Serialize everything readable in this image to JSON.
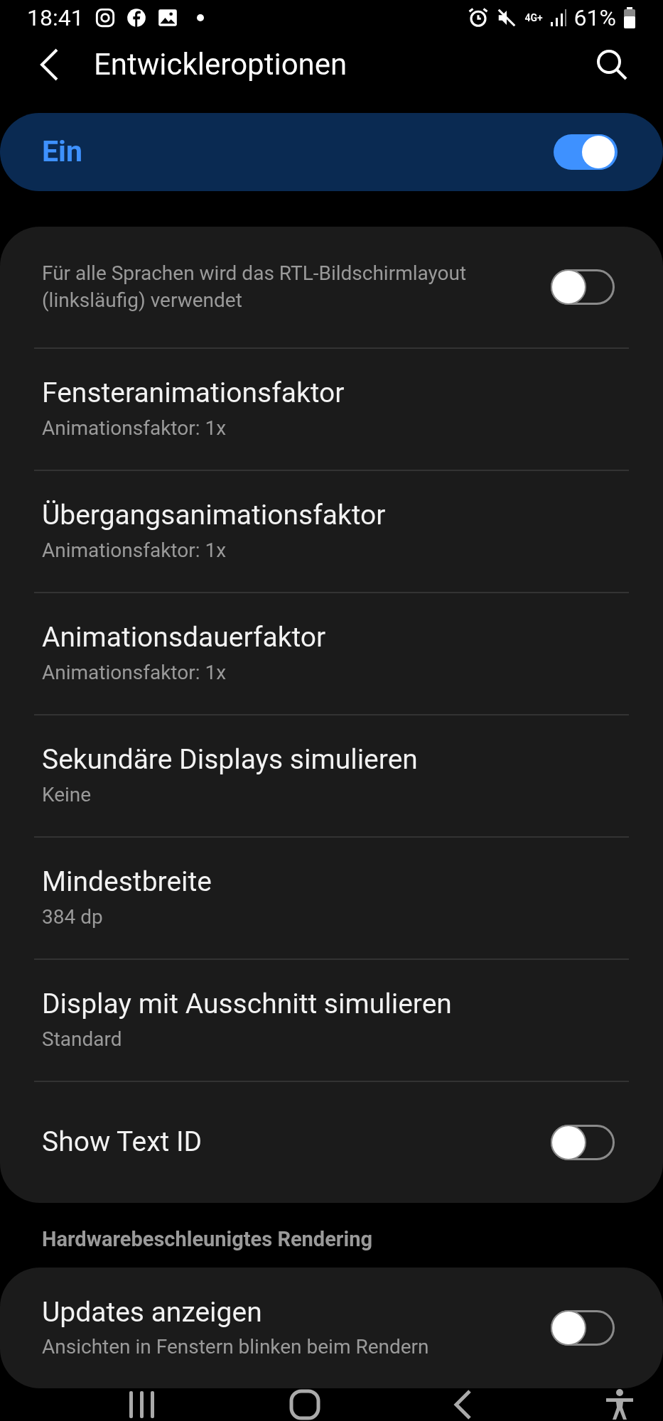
{
  "status_bar": {
    "time": "18:41",
    "network": "4G+",
    "battery": "61%"
  },
  "header": {
    "title": "Entwickleroptionen"
  },
  "master_switch": {
    "label": "Ein",
    "on": true
  },
  "settings": [
    {
      "kind": "toggle",
      "subtitle": "Für alle Sprachen wird das RTL-Bildschirmlayout (linksläufig) verwendet",
      "on": false
    },
    {
      "kind": "value",
      "title": "Fensteranimationsfaktor",
      "subtitle": "Animationsfaktor: 1x"
    },
    {
      "kind": "value",
      "title": "Übergangsanimationsfaktor",
      "subtitle": "Animationsfaktor: 1x"
    },
    {
      "kind": "value",
      "title": "Animationsdauerfaktor",
      "subtitle": "Animationsfaktor: 1x"
    },
    {
      "kind": "value",
      "title": "Sekundäre Displays simulieren",
      "subtitle": "Keine"
    },
    {
      "kind": "value",
      "title": "Mindestbreite",
      "subtitle": "384 dp"
    },
    {
      "kind": "value",
      "title": "Display mit Ausschnitt simulieren",
      "subtitle": "Standard"
    },
    {
      "kind": "toggle",
      "title": "Show Text ID",
      "on": false
    }
  ],
  "section": {
    "title": "Hardwarebeschleunigtes Rendering",
    "settings": [
      {
        "kind": "toggle",
        "title": "Updates anzeigen",
        "subtitle": "Ansichten in Fenstern blinken beim Rendern",
        "on": false
      }
    ]
  }
}
